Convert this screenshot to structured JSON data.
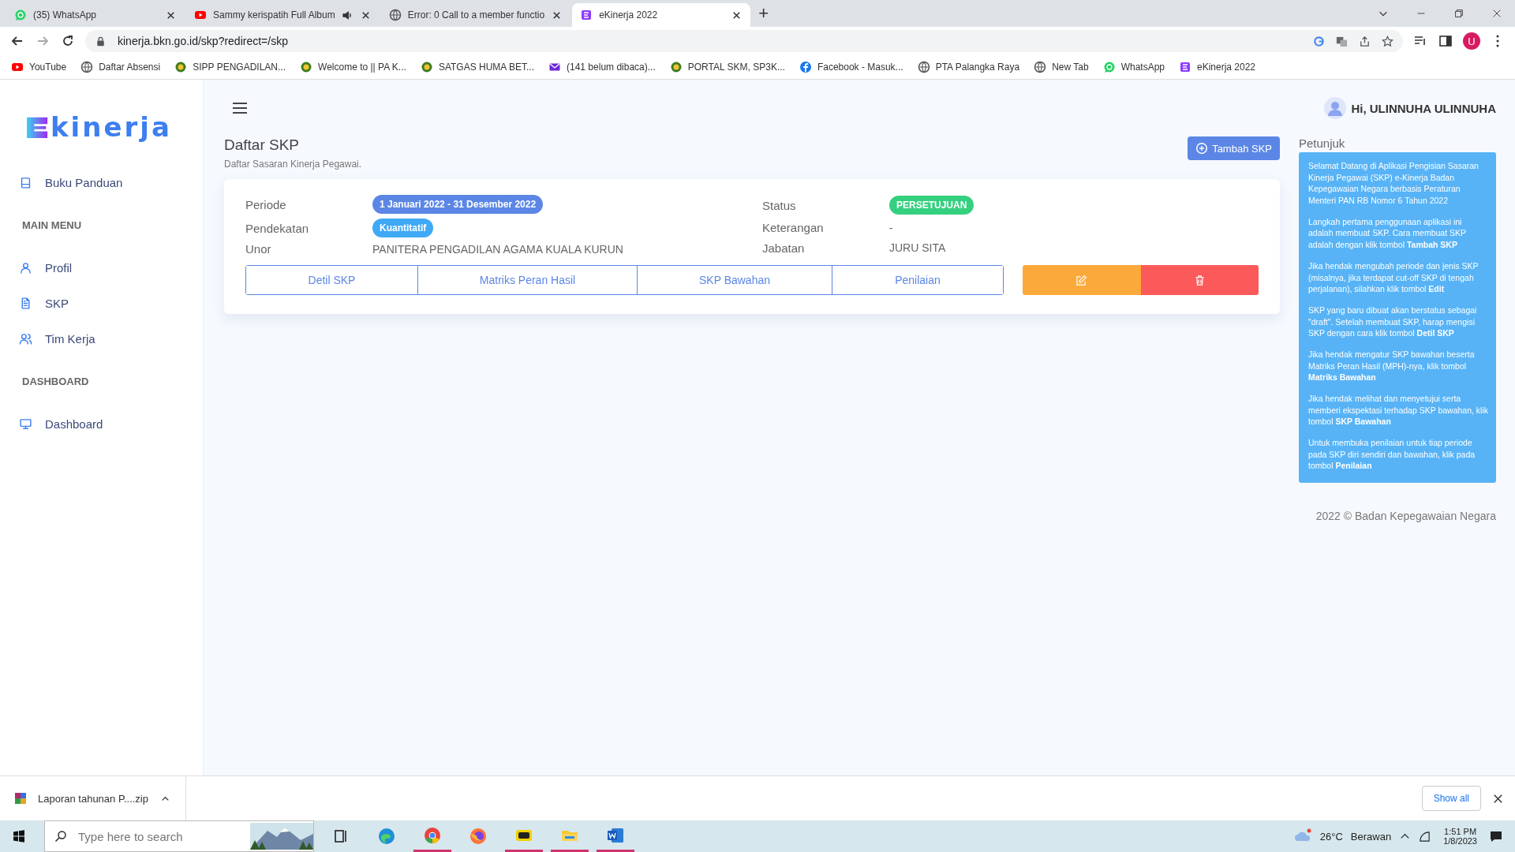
{
  "browser": {
    "tabs": [
      {
        "title": "(35) WhatsApp",
        "audio": false,
        "selected": false
      },
      {
        "title": "Sammy kerispatih Full Album",
        "audio": true,
        "selected": false
      },
      {
        "title": "Error: 0 Call to a member functio",
        "audio": false,
        "selected": false
      },
      {
        "title": "eKinerja 2022",
        "audio": false,
        "selected": true
      }
    ],
    "new_tab": "+",
    "address": "kinerja.bkn.go.id/skp?redirect=/skp",
    "profile": "U",
    "bookmarks": [
      "YouTube",
      "Daftar Absensi",
      "SIPP PENGADILAN...",
      "Welcome to || PA K...",
      "SATGAS HUMA BET...",
      "(141 belum dibaca)...",
      "PORTAL SKM, SP3K...",
      "Facebook - Masuk...",
      "PTA Palangka Raya",
      "New Tab",
      "WhatsApp",
      "eKinerja 2022"
    ]
  },
  "sidebar": {
    "logo": "kinerja",
    "items": [
      {
        "kind": "link",
        "label": "Buku Panduan"
      },
      {
        "kind": "heading",
        "label": "MAIN MENU"
      },
      {
        "kind": "link",
        "label": "Profil"
      },
      {
        "kind": "link",
        "label": "SKP"
      },
      {
        "kind": "link",
        "label": "Tim Kerja"
      },
      {
        "kind": "heading",
        "label": "DASHBOARD"
      },
      {
        "kind": "link",
        "label": "Dashboard"
      }
    ]
  },
  "header": {
    "greeting": "Hi, ULINNUHA ULINNUHA"
  },
  "page": {
    "title": "Daftar SKP",
    "subtitle": "Daftar Sasaran Kinerja Pegawai.",
    "add_button": "Tambah SKP"
  },
  "skp_card": {
    "left_fields": [
      {
        "label": "Periode",
        "kind": "badge",
        "value": "1 Januari 2022 - 31 Desember 2022",
        "color": "#5b86e5"
      },
      {
        "label": "Pendekatan",
        "kind": "badge",
        "value": "Kuantitatif",
        "color": "#3fa9f5"
      },
      {
        "label": "Unor",
        "kind": "text",
        "value": "PANITERA PENGADILAN AGAMA KUALA KURUN"
      }
    ],
    "right_fields": [
      {
        "label": "Status",
        "kind": "badge",
        "value": "PERSETUJUAN",
        "color": "#35d07f"
      },
      {
        "label": "Keterangan",
        "kind": "text",
        "value": "-"
      },
      {
        "label": "Jabatan",
        "kind": "text",
        "value": "JURU SITA"
      }
    ],
    "links": [
      "Detil SKP",
      "Matriks Peran Hasil",
      "SKP Bawahan",
      "Penilaian"
    ],
    "actions": [
      {
        "kind": "edit",
        "color": "#fca93b"
      },
      {
        "kind": "delete",
        "color": "#fc5a5a"
      }
    ]
  },
  "petunjuk": {
    "title": "Petunjuk",
    "paragraphs": [
      "Selamat Datang di Aplikasi Pengisian Sasaran Kinerja Pegawai (SKP) e-Kinerja Badan Kepegawaian Negara berbasis Peraturan Menteri PAN RB Nomor 6 Tahun 2022",
      "Langkah pertama penggunaan aplikasi ini adalah membuat SKP. Cara membuat SKP adalah dengan klik tombol **Tambah SKP**",
      "Jika hendak mengubah periode dan jenis SKP (misalnya, jika terdapat cut-off SKP di tengah perjalanan), silahkan klik tombol **Edit**",
      "SKP yang baru dibuat akan berstatus sebagai \"draft\". Setelah membuat SKP, harap mengisi SKP dengan cara klik tombol **Detil SKP**",
      "Jika hendak mengatur SKP bawahan beserta Matriks Peran Hasil (MPH)-nya, klik tombol **Matriks Bawahan**",
      "Jika hendak melihat dan menyetujui serta memberi ekspektasi terhadap SKP bawahan, klik tombol **SKP Bawahan**",
      "Untuk membuka penilaian untuk tiap periode pada SKP diri sendiri dan bawahan, klik pada tombol **Penilaian**"
    ]
  },
  "footer": "2022 © Badan Kepegawaian Negara",
  "download_bar": {
    "file": "Laporan tahunan P....zip",
    "show_all": "Show all"
  },
  "taskbar": {
    "search_placeholder": "Type here to search",
    "apps": [
      {
        "selected": false
      },
      {
        "selected": false
      },
      {
        "selected": true
      },
      {
        "selected": false
      },
      {
        "selected": true
      },
      {
        "selected": true
      },
      {
        "selected": true
      }
    ],
    "temperature": "26°C",
    "weather": "Berawan",
    "time": "1:51 PM",
    "date": "1/8/2023"
  }
}
